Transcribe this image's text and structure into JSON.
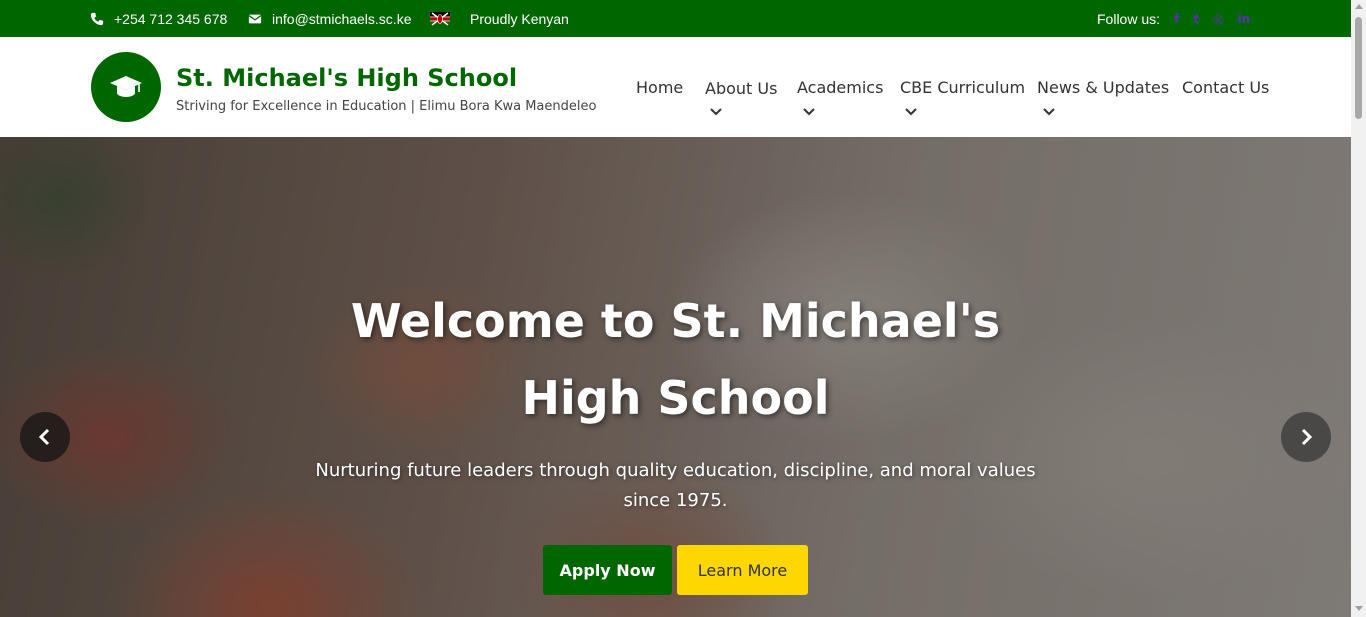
{
  "topbar": {
    "phone": "+254 712 345 678",
    "email": "info@stmichaels.sc.ke",
    "country_label": "Proudly Kenyan",
    "follow_label": "Follow us:",
    "social_icons": [
      "facebook-icon",
      "twitter-icon",
      "instagram-icon",
      "linkedin-icon"
    ],
    "social_color": "#5b2fb5"
  },
  "brand": {
    "title": "St. Michael's High School",
    "tagline": "Striving for Excellence in Education | Elimu Bora Kwa Maendeleo",
    "icon": "graduation-cap-icon"
  },
  "nav": {
    "home": "Home",
    "about": "About Us",
    "academics": "Academics",
    "cbe": "CBE Curriculum",
    "news": "News & Updates",
    "contact": "Contact Us"
  },
  "hero": {
    "title": "Welcome to St. Michael's High School",
    "subtitle": "Nurturing future leaders through quality education, discipline, and moral values since 1975.",
    "apply_label": "Apply Now",
    "learn_label": "Learn More"
  },
  "colors": {
    "primary_green": "#006600",
    "accent_yellow": "#ffd700",
    "text_dark": "#333333"
  }
}
